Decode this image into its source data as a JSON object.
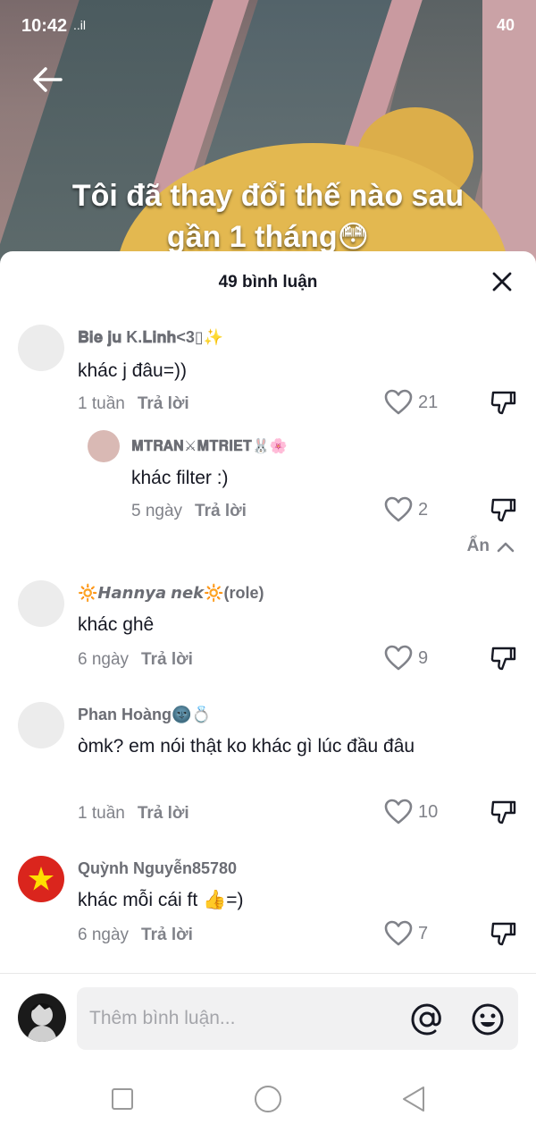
{
  "status_bar": {
    "time": "10:42",
    "signal": "..il",
    "right_text": "40"
  },
  "video": {
    "overlay_line1": "Tôi đã thay đổi thế nào sau",
    "overlay_line2": "gần 1 tháng😳"
  },
  "sheet": {
    "title": "49 bình luận",
    "reply_label": "Trả lời",
    "collapse_label": "Ẩn"
  },
  "comments": [
    {
      "username": "𝐁𝐢𝐞 𝐣𝐮 K.𝐋𝐢𝐧𝐡<3▯✨",
      "text": "khác j đâu=))",
      "time": "1 tuần",
      "likes": "21"
    },
    {
      "username": "𝐌𝐓𝐑𝐀𝐍⚔𝐌𝐓𝐑𝐈𝐄𝐓🐰🌸",
      "text": "khác filter :)",
      "time": "5 ngày",
      "likes": "2"
    },
    {
      "username": "🔆𝙃𝙖𝙣𝙣𝙮𝙖 𝙣𝙚𝙠🔆(role)",
      "text": "khác ghê",
      "time": "6 ngày",
      "likes": "9"
    },
    {
      "username": "Phan Hoàng🌚💍",
      "text": "òmk? em nói thật ko khác gì lúc đầu đâu",
      "time": "1 tuần",
      "likes": "10"
    },
    {
      "username": "Quỳnh Nguyễn85780",
      "text": "khác mỗi cái ft 👍=)",
      "time": "6 ngày",
      "likes": "7"
    }
  ],
  "input": {
    "placeholder": "Thêm bình luận..."
  },
  "colors": {
    "accent_red": "#da251d",
    "star_yellow": "#ffde00",
    "text_primary": "#161823",
    "text_secondary": "#808289"
  },
  "icons": [
    "back-arrow-icon",
    "close-icon",
    "heart-icon",
    "dislike-icon",
    "chevron-up-icon",
    "at-icon",
    "emoji-icon",
    "nav-square-icon",
    "nav-circle-icon",
    "nav-back-triangle-icon"
  ]
}
